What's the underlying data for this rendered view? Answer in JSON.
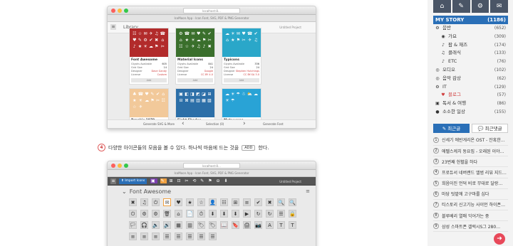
{
  "shot1": {
    "url": "localhost:8…",
    "tab_title": "IcoMoon App - Icon Font, SVG, PDF & PNG Generator",
    "library_label": "Library",
    "project": "Untitled Project",
    "cards": [
      {
        "name": "Font Awesome",
        "color": "#b22b2b",
        "rows": [
          [
            "Glyphs Available",
            "605"
          ],
          [
            "Grid Size",
            "14"
          ],
          [
            "Designer",
            "Dave Gandy"
          ],
          [
            "License",
            "Custom"
          ]
        ],
        "icons": "☷☆✉✈♫☎♥✎⚙✔✖⌂♪★☀☁⚑✂"
      },
      {
        "name": "Material Icons",
        "color": "#3a6f2c",
        "rows": [
          [
            "Glyphs Available",
            "841"
          ],
          [
            "Grid Size",
            "24"
          ],
          [
            "Designer",
            "Google"
          ],
          [
            "License",
            "CC BY 4.0"
          ]
        ],
        "icons": "⚙☎✉♥✎✔⌂★☀☁⚑✂☷☆✈♫♪✖"
      },
      {
        "name": "Typicons",
        "color": "#2aa7c9",
        "rows": [
          [
            "Glyphs Available",
            "336"
          ],
          [
            "Grid Size",
            "24"
          ],
          [
            "Designer",
            "Stephen Hutchings"
          ],
          [
            "License",
            "CC BY-SA 3.0"
          ]
        ],
        "icons": "☁☀✉♥☎✔⌂★⚑✂✈♫"
      },
      {
        "name": "Brankic 1979",
        "color": "#f2c99a",
        "rows": [],
        "icons": "♣☎♥✎✔⌂★☀☁⚑✂☷☆✈"
      },
      {
        "name": "Eight Shades",
        "color": "#2c6fa8",
        "rows": [],
        "icons": "▣◧◨◩◪⊞⊟⊠▤▥▦▧"
      },
      {
        "name": "Meteocons",
        "color": "#29a3d6",
        "rows": [],
        "icons": "☁☀☂☃⛅☁☀☂"
      }
    ],
    "add_label": "Add",
    "footer_left": "Generate SVG & More",
    "footer_mid": "Selection (0)",
    "footer_right": "Generate Font"
  },
  "caption": {
    "num": "4",
    "text1": "다양한 아이콘들의 모음을 볼 수 있다. 하나씩 마음에 드는 것을",
    "kbd": "ADD",
    "text2": "한다."
  },
  "shot2": {
    "tab_title": "IcoMoon App - Icon Font, SVG, PDF & PNG Generator",
    "import_label": "Import Icons",
    "project": "Untitled Project",
    "section": "Font Awesome",
    "icons": [
      "✖",
      "♫",
      "⏻",
      "✉",
      "♥",
      "★",
      "☆",
      "👤",
      "☷",
      "⊞",
      "≡",
      "✔",
      "✖",
      "🔍",
      "🔍",
      "⏻",
      "⚙",
      "⚙",
      "🗑",
      "⌂",
      "📄",
      "⏱",
      "⬇",
      "⬇",
      "⬇",
      "▶",
      "↻",
      "↻",
      "☰",
      "🔒",
      "🏳",
      "🎧",
      "🔈",
      "🔊",
      "▦",
      "▥",
      "🏷",
      "🏷",
      "📖",
      "🔖",
      "🖨",
      "📷",
      "A",
      "T",
      "T",
      "≡",
      "≡",
      "≡",
      "☰",
      "☰",
      "☰",
      "☰",
      "☰"
    ]
  },
  "sidebar": {
    "top_icons": [
      "⌂",
      "✎",
      "⚙",
      "✉"
    ],
    "mystory": "MY STORY",
    "mystory_count": "(1186)",
    "cats": [
      {
        "icon": "⚙",
        "label": "음반",
        "count": "(652)",
        "sub": false
      },
      {
        "icon": "◉",
        "label": "가요",
        "count": "(309)",
        "sub": true
      },
      {
        "icon": "♪",
        "label": "팝 & 재즈",
        "count": "(174)",
        "sub": true
      },
      {
        "icon": "♫",
        "label": "클래식",
        "count": "(133)",
        "sub": true
      },
      {
        "icon": "♪",
        "label": "ETC",
        "count": "(76)",
        "sub": true
      },
      {
        "icon": "◎",
        "label": "오디오",
        "count": "(102)",
        "sub": false
      },
      {
        "icon": "◎",
        "label": "음악 감상",
        "count": "(62)",
        "sub": false
      },
      {
        "icon": "⚙",
        "label": "IT",
        "count": "(129)",
        "sub": false
      },
      {
        "icon": "♥",
        "label": "블로그",
        "count": "(57)",
        "sub": true,
        "red": true
      },
      {
        "icon": "▣",
        "label": "독서 & 여행",
        "count": "(86)",
        "sub": false
      },
      {
        "icon": "●",
        "label": "소소한 일상",
        "count": "(155)",
        "sub": false
      }
    ],
    "tabs": [
      "최근글",
      "최근댓글"
    ],
    "posts": [
      "신세기 에반게리온 OST - 잔혹한…",
      "에펠스케치 동요집 - 오래된 이야…",
      "23번째 헌혈을 하다",
      "프로듀서 네버랜드 앨범 리뷰 지드…",
      "희음이진 언덕 비로 무대로 달랑…",
      "마당 텃밭에 고구마를 심다",
      "티스토리 신고기능 사이언 하이폰…",
      "블루베리 열매 익어가는 중",
      "삼성 스마트폰 갤럭시S그 280…"
    ]
  }
}
